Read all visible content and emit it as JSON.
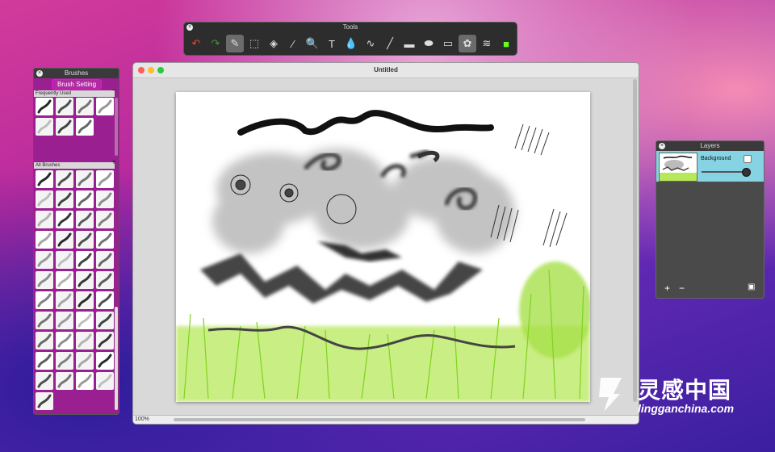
{
  "tools_panel": {
    "title": "Tools",
    "tools": [
      {
        "name": "undo-icon",
        "glyph": "↶",
        "color": "#e04a35"
      },
      {
        "name": "redo-icon",
        "glyph": "↷",
        "color": "#3a9a3a"
      },
      {
        "name": "brush-icon",
        "glyph": "✎",
        "selected": true
      },
      {
        "name": "select-rect-icon",
        "glyph": "⬚"
      },
      {
        "name": "fill-bucket-icon",
        "glyph": "◈"
      },
      {
        "name": "eyedropper-icon",
        "glyph": "⁄"
      },
      {
        "name": "zoom-icon",
        "glyph": "🔍"
      },
      {
        "name": "text-icon",
        "glyph": "T"
      },
      {
        "name": "blur-drop-icon",
        "glyph": "💧"
      },
      {
        "name": "curve-icon",
        "glyph": "∿"
      },
      {
        "name": "line-icon",
        "glyph": "╱"
      },
      {
        "name": "rectangle-icon",
        "glyph": "▬"
      },
      {
        "name": "ellipse-icon",
        "glyph": "⬬"
      },
      {
        "name": "rounded-rect-icon",
        "glyph": "▭"
      },
      {
        "name": "stamp-icon",
        "glyph": "✿",
        "selected": true
      },
      {
        "name": "layers-icon",
        "glyph": "≋"
      },
      {
        "name": "color-swatch-icon",
        "glyph": "■",
        "color": "#66ff1a"
      }
    ]
  },
  "brushes_panel": {
    "title": "Brushes",
    "setting_button": "Brush Setting",
    "frequently_used": "Frequently Used",
    "all_brushes": "All Brushes"
  },
  "document_window": {
    "title": "Untitled",
    "zoom": "100%"
  },
  "layers_panel": {
    "title": "Layers",
    "layers": [
      {
        "name": "Background",
        "opacity": 0.9
      }
    ]
  },
  "watermark": {
    "cn": "灵感中国",
    "en": "lingganchina.com"
  },
  "colors": {
    "accent_green": "#66ff1a",
    "layer_highlight": "#86d3e4",
    "brushes_bg": "#9a1f90"
  }
}
